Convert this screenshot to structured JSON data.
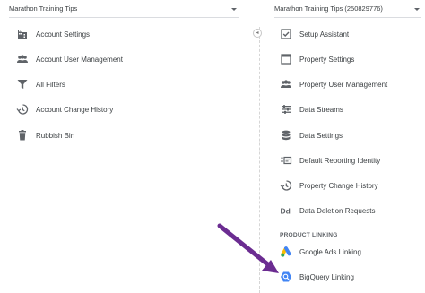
{
  "left": {
    "selector": "Marathon Training Tips",
    "items": [
      {
        "label": "Account Settings",
        "icon": "building-icon"
      },
      {
        "label": "Account User Management",
        "icon": "people-icon"
      },
      {
        "label": "All Filters",
        "icon": "filter-icon"
      },
      {
        "label": "Account Change History",
        "icon": "history-icon"
      },
      {
        "label": "Rubbish Bin",
        "icon": "trash-icon"
      }
    ]
  },
  "right": {
    "selector": "Marathon Training Tips (250829776)",
    "items": [
      {
        "label": "Setup Assistant",
        "icon": "checkbox-icon"
      },
      {
        "label": "Property Settings",
        "icon": "window-icon"
      },
      {
        "label": "Property User Management",
        "icon": "people-icon"
      },
      {
        "label": "Data Streams",
        "icon": "streams-icon"
      },
      {
        "label": "Data Settings",
        "icon": "database-icon"
      },
      {
        "label": "Default Reporting Identity",
        "icon": "identity-icon"
      },
      {
        "label": "Property Change History",
        "icon": "history-icon"
      },
      {
        "label": "Data Deletion Requests",
        "icon": "dd-icon"
      }
    ],
    "section_label": "PRODUCT LINKING",
    "linking": [
      {
        "label": "Google Ads Linking",
        "icon": "google-ads-icon"
      },
      {
        "label": "BigQuery Linking",
        "icon": "bigquery-icon"
      }
    ]
  },
  "colors": {
    "arrow": "#6b2c91",
    "icon": "#5f6368",
    "text": "#3c4043",
    "bigquery": "#4285f4"
  }
}
